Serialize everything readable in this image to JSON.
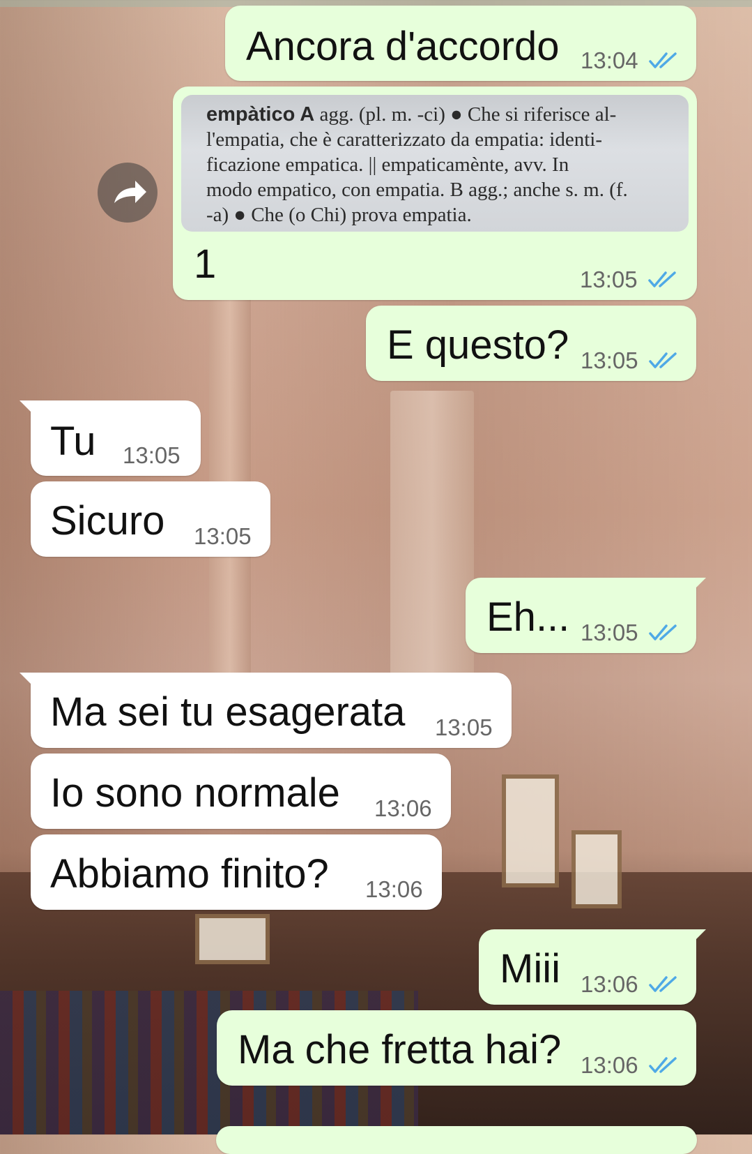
{
  "messages": [
    {
      "type": "out",
      "text": "Ancora d'accordo",
      "time": "13:04",
      "ticks": "read"
    },
    {
      "type": "out-image",
      "caption": "1",
      "time": "13:05",
      "ticks": "read",
      "image_lines": [
        {
          "bold": "empàtico A",
          "rest": " agg. (pl. m. -ci) ● Che si riferisce al-"
        },
        {
          "bold": "",
          "rest": "l'empatia, che è caratterizzato da empatia: identi-"
        },
        {
          "bold": "",
          "rest": "ficazione empatica. || empaticamènte, avv. In"
        },
        {
          "bold": "",
          "rest": "modo empatico, con empatia. B agg.; anche s. m. (f."
        },
        {
          "bold": "",
          "rest": "-a) ● Che (o Chi) prova empatia."
        }
      ]
    },
    {
      "type": "out",
      "text": "E questo?",
      "time": "13:05",
      "ticks": "read"
    },
    {
      "type": "in",
      "text": "Tu",
      "time": "13:05"
    },
    {
      "type": "in",
      "text": "Sicuro",
      "time": "13:05"
    },
    {
      "type": "out",
      "text": "Eh...",
      "time": "13:05",
      "ticks": "read"
    },
    {
      "type": "in",
      "text": "Ma sei tu esagerata",
      "time": "13:05"
    },
    {
      "type": "in",
      "text": "Io sono normale",
      "time": "13:06"
    },
    {
      "type": "in",
      "text": "Abbiamo finito?",
      "time": "13:06"
    },
    {
      "type": "out",
      "text": "Miii",
      "time": "13:06",
      "ticks": "read"
    },
    {
      "type": "out",
      "text": "Ma che fretta hai?",
      "time": "13:06",
      "ticks": "read"
    }
  ],
  "icons": {
    "forward": "forward-arrow-icon",
    "read_ticks": "double-check-icon"
  },
  "colors": {
    "outgoing": "#e7ffdb",
    "incoming": "#ffffff",
    "read_tick": "#4fa9e6"
  }
}
